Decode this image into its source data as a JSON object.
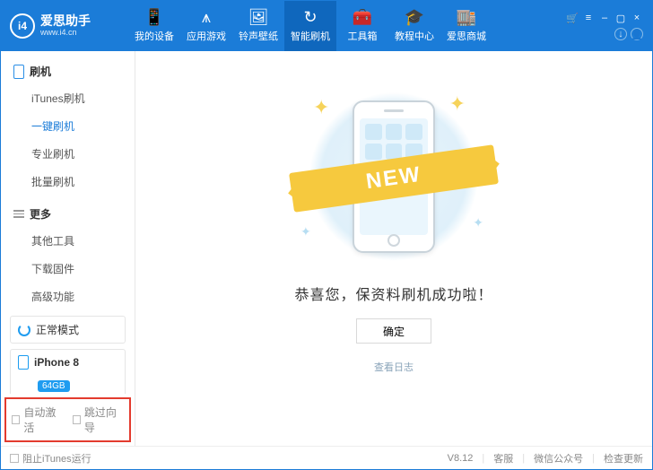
{
  "app": {
    "name": "爱思助手",
    "subdomain": "www.i4.cn",
    "logo_text": "i4"
  },
  "top_nav": [
    {
      "label": "我的设备",
      "icon": "📱"
    },
    {
      "label": "应用游戏",
      "icon": "⩚"
    },
    {
      "label": "铃声壁纸",
      "icon": "🖼"
    },
    {
      "label": "智能刷机",
      "icon": "↻",
      "active": true
    },
    {
      "label": "工具箱",
      "icon": "🧰"
    },
    {
      "label": "教程中心",
      "icon": "🎓"
    },
    {
      "label": "爱思商城",
      "icon": "🏬"
    }
  ],
  "window_controls": {
    "cart": "🛒",
    "menu": "≡",
    "min": "–",
    "max": "▢",
    "close": "×"
  },
  "header_buttons": {
    "download": "↓",
    "user": "👤"
  },
  "sidebar": {
    "flash_heading": "刷机",
    "flash_items": [
      "iTunes刷机",
      "一键刷机",
      "专业刷机",
      "批量刷机"
    ],
    "flash_active_index": 1,
    "more_heading": "更多",
    "more_items": [
      "其他工具",
      "下载固件",
      "高级功能"
    ],
    "mode": {
      "label": "正常模式"
    },
    "device": {
      "name": "iPhone 8",
      "storage": "64GB"
    },
    "bottom_checks": {
      "auto_activate": "自动激活",
      "skip_setup": "跳过向导"
    }
  },
  "main": {
    "ribbon": "NEW",
    "success_text": "恭喜您，保资料刷机成功啦！",
    "ok_button": "确定",
    "view_log": "查看日志"
  },
  "statusbar": {
    "block_itunes": "阻止iTunes运行",
    "version": "V8.12",
    "links": [
      "客服",
      "微信公众号",
      "检查更新"
    ]
  }
}
